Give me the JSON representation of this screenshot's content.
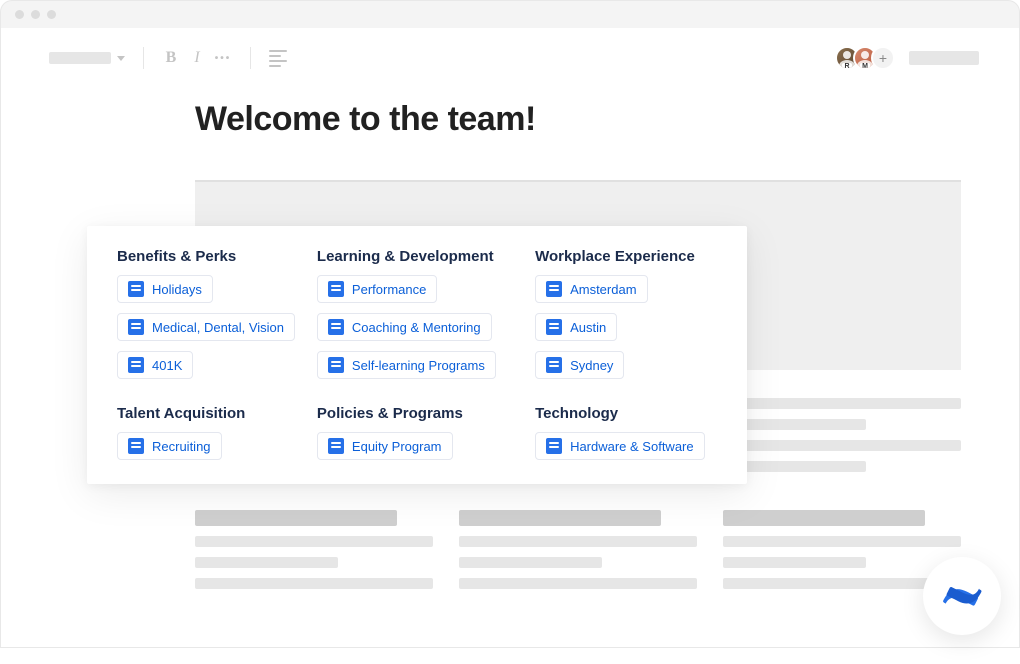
{
  "page": {
    "title": "Welcome to the team!"
  },
  "toolbar": {
    "avatars": [
      {
        "initial": "R"
      },
      {
        "initial": "M"
      }
    ],
    "add_label": "+"
  },
  "categories": [
    {
      "title": "Benefits & Perks",
      "links": [
        "Holidays",
        "Medical, Dental, Vision",
        "401K"
      ]
    },
    {
      "title": "Learning & Development",
      "links": [
        "Performance",
        "Coaching & Mentoring",
        "Self-learning Programs"
      ]
    },
    {
      "title": "Workplace Experience",
      "links": [
        "Amsterdam",
        "Austin",
        "Sydney"
      ]
    },
    {
      "title": "Talent Acquisition",
      "links": [
        "Recruiting"
      ]
    },
    {
      "title": "Policies & Programs",
      "links": [
        "Equity Program"
      ]
    },
    {
      "title": "Technology",
      "links": [
        "Hardware & Software"
      ]
    }
  ]
}
